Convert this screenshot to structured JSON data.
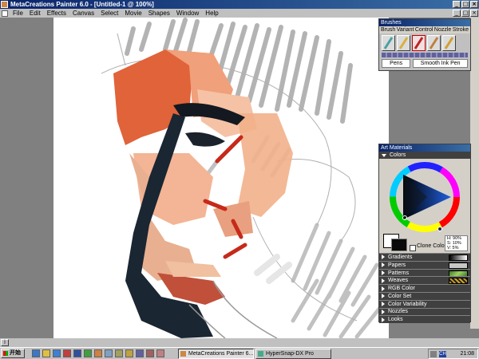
{
  "window": {
    "title": "MetaCreations Painter 6.0 - [Untitled-1 @ 100%]",
    "controls": [
      "_",
      "□",
      "×"
    ]
  },
  "menu": [
    "File",
    "Edit",
    "Effects",
    "Canvas",
    "Select",
    "Movie",
    "Shapes",
    "Window",
    "Help"
  ],
  "doc_controls": [
    "_",
    "□",
    "×"
  ],
  "brush_palette": {
    "title": "Brushes",
    "menu": [
      "Brush",
      "Variant",
      "Control",
      "Nozzle",
      "Stroke"
    ],
    "brushes": [
      {
        "icon": "airbrush-icon",
        "color": "#4aa0a0"
      },
      {
        "icon": "pencil-icon",
        "color": "#d8b040"
      },
      {
        "icon": "felt-pen-icon",
        "color": "#c02020"
      },
      {
        "icon": "chalk-icon",
        "color": "#c08040"
      },
      {
        "icon": "pen-icon",
        "color": "#d0a030"
      }
    ],
    "brush_name": "Pens",
    "variant_name": "Smooth Ink Pen"
  },
  "art_materials": {
    "title": "Art Materials",
    "colors_label": "Colors",
    "clone_color_label": "Clone Color",
    "hsv": {
      "h": "H: 90%",
      "s": "S: 10%",
      "v": "V: 5%"
    },
    "sections": [
      {
        "label": "Gradients",
        "swatch": "gradient"
      },
      {
        "label": "Papers",
        "swatch": "paper"
      },
      {
        "label": "Patterns",
        "swatch": "pattern"
      },
      {
        "label": "Weaves",
        "swatch": "weave"
      },
      {
        "label": "RGB Color"
      },
      {
        "label": "Color Set"
      },
      {
        "label": "Color Variability"
      },
      {
        "label": "Nozzles"
      },
      {
        "label": "Looks"
      }
    ]
  },
  "taskbar": {
    "start_label": "开始",
    "tasks": [
      {
        "label": "MetaCreations Painter 6...",
        "active": true
      },
      {
        "label": "HyperSnap-DX Pro",
        "active": false
      }
    ],
    "clock": "21:08"
  }
}
